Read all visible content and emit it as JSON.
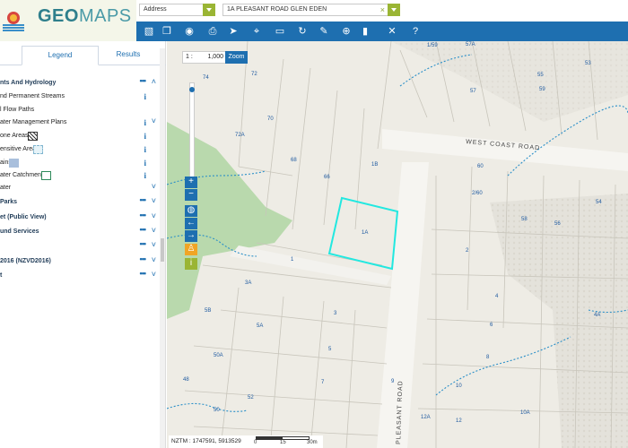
{
  "app": {
    "logo_text_bold": "GEO",
    "logo_text_light": "MAPS",
    "brand_color": "#2e7f8c",
    "accent_color": "#1e6fb0",
    "dropdown_color": "#9ab534"
  },
  "search": {
    "type_value": "Address",
    "address_value": "1A PLEASANT ROAD GLEN EDEN",
    "clear_icon": "close-icon"
  },
  "toolbar": {
    "tools": [
      {
        "name": "base-map-icon",
        "glyph": "▧"
      },
      {
        "name": "layers-icon",
        "glyph": "❐"
      },
      {
        "name": "view-icon",
        "glyph": "◉"
      },
      {
        "name": "print-icon",
        "glyph": "⎙"
      },
      {
        "name": "select-pointer-icon",
        "glyph": "➤"
      },
      {
        "name": "locate-icon",
        "glyph": "⌖"
      },
      {
        "name": "measure-icon",
        "glyph": "▭"
      },
      {
        "name": "history-icon",
        "glyph": "↻"
      },
      {
        "name": "streetview-icon",
        "glyph": "✎"
      },
      {
        "name": "geotag-icon",
        "glyph": "⊕"
      },
      {
        "name": "bookmark-icon",
        "glyph": "▮"
      },
      {
        "name": "tools-icon",
        "glyph": "✕"
      },
      {
        "name": "help-icon",
        "glyph": "?"
      }
    ]
  },
  "sidebar": {
    "tabs": {
      "legend": "Legend",
      "results": "Results"
    },
    "rows": [
      {
        "label": "nts And Hydrology",
        "bold": true,
        "dots": true,
        "chev": "˄"
      },
      {
        "label": "nd Permanent Streams",
        "info": true
      },
      {
        "label": "l Flow Paths"
      },
      {
        "label": "ater Management Plans",
        "info": true,
        "chev": "˅"
      },
      {
        "label": "one Areas",
        "info": true,
        "swatch": "hatch"
      },
      {
        "label": "ensitive Area",
        "info": true,
        "swatch": "light"
      },
      {
        "label": "ains",
        "info": true,
        "swatch": "blue"
      },
      {
        "label": "ater Catchments",
        "info": true,
        "swatch": "green"
      },
      {
        "label": "ater",
        "chev": "˅"
      },
      {
        "label": "Parks",
        "bold": true,
        "dots": true,
        "chev": "˅"
      },
      {
        "label": "et (Public View)",
        "bold": true,
        "dots": true,
        "chev": "˅"
      },
      {
        "label": "und Services",
        "bold": true,
        "dots": true,
        "chev": "˅"
      },
      {
        "label": "",
        "dots": true,
        "chev": "˅"
      },
      {
        "label": "2016 (NZVD2016)",
        "bold": true,
        "dots": true,
        "chev": "˅"
      },
      {
        "label": "t",
        "bold": true,
        "dots": true,
        "chev": "˅"
      }
    ],
    "dots_text": "•••",
    "info_text": "i"
  },
  "map": {
    "scale_prefix": "1 :",
    "scale_value": "1,000",
    "zoom_button": "Zoom",
    "road_labels": {
      "west_coast": "WEST COAST ROAD",
      "pleasant": "PLEASANT ROAD"
    },
    "lot_labels": [
      "74",
      "72",
      "70",
      "72A",
      "68",
      "66",
      "1B",
      "1A",
      "1",
      "3A",
      "5B",
      "5A",
      "3",
      "5",
      "50A",
      "48",
      "52",
      "7",
      "50",
      "9",
      "1/59",
      "57A",
      "57",
      "53",
      "55",
      "59",
      "60",
      "2/60",
      "58",
      "56",
      "54",
      "2",
      "4",
      "6",
      "8",
      "10",
      "12A",
      "12",
      "10A",
      "4A"
    ],
    "coords_text": "NZTM : 1747591, 5913529",
    "scale_labels": [
      "0",
      "15",
      "30m"
    ]
  }
}
